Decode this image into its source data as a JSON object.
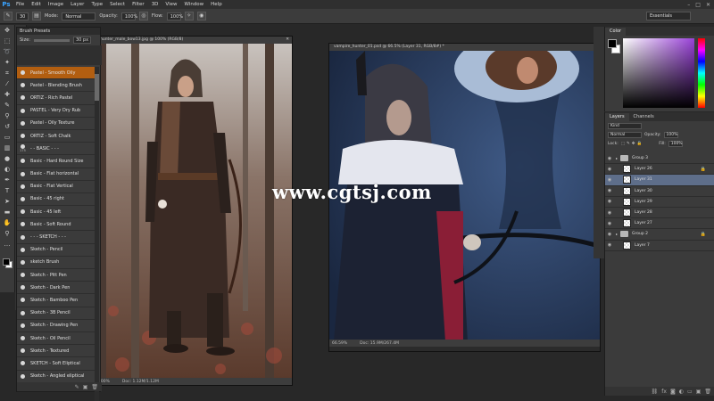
{
  "menu": [
    "File",
    "Edit",
    "Image",
    "Layer",
    "Type",
    "Select",
    "Filter",
    "3D",
    "View",
    "Window",
    "Help"
  ],
  "app_logo": "Ps",
  "options": {
    "mode_label": "Mode:",
    "mode_value": "Normal",
    "opacity_label": "Opacity:",
    "opacity_value": "100%",
    "flow_label": "Flow:",
    "flow_value": "100%",
    "workspace": "Essentials"
  },
  "brush_panel": {
    "title": "Brush Presets",
    "size_label": "Size:",
    "size_value": "30 px",
    "items": [
      {
        "label": "Pastel - Smooth Oily",
        "size": "",
        "selected": true
      },
      {
        "label": "Pastel - Blending Brush",
        "size": ""
      },
      {
        "label": "ORTIZ - Rich Pastel",
        "size": ""
      },
      {
        "label": "PASTEL - Very Dry Rub",
        "size": ""
      },
      {
        "label": "Pastel - Oily Texture",
        "size": ""
      },
      {
        "label": "ORTIZ - Soft Chalk",
        "size": ""
      },
      {
        "label": "- - BASIC - - -",
        "size": "175"
      },
      {
        "label": "Basic - Hard Round Size",
        "size": ""
      },
      {
        "label": "Basic - Flat horizontal",
        "size": ""
      },
      {
        "label": "Basic - Flat Vertical",
        "size": ""
      },
      {
        "label": "Basic - 45 right",
        "size": ""
      },
      {
        "label": "Basic - 45 left",
        "size": ""
      },
      {
        "label": "Basic - Soft Round",
        "size": ""
      },
      {
        "label": "- - - SKETCH - - -",
        "size": ""
      },
      {
        "label": "Sketch - Pencil",
        "size": ""
      },
      {
        "label": "sketch Brush",
        "size": ""
      },
      {
        "label": "Sketch - Pitt Pen",
        "size": ""
      },
      {
        "label": "Sketch - Dark Pen",
        "size": ""
      },
      {
        "label": "Sketch - Bamboo Pen",
        "size": ""
      },
      {
        "label": "Sketch - 3B Pencil",
        "size": ""
      },
      {
        "label": "Sketch - Drawing Pen",
        "size": ""
      },
      {
        "label": "Sketch - Oil Pencil",
        "size": ""
      },
      {
        "label": "Sketch - Textured",
        "size": ""
      },
      {
        "label": "SKETCH - Soft Eliptical",
        "size": ""
      },
      {
        "label": "Sketch - Angled eliptical",
        "size": ""
      }
    ]
  },
  "doc1": {
    "title": "hunter_male_bow13.jpg @ 100% (RGB/8)",
    "zoom": "100%",
    "doc_size": "Doc: 1.12M/1.12M"
  },
  "doc2": {
    "title": "vampire_hunter_01.psd @ 66.5% (Layer 31, RGB/8#) *",
    "zoom": "66.59%",
    "doc_size": "Doc: 15.9M/267.4M"
  },
  "watermark": "www.cgtsj.com",
  "color_panel": {
    "tab1": "Color",
    "tab2": ""
  },
  "layers_panel": {
    "tab1": "Layers",
    "tab2": "Channels",
    "kind": "Kind",
    "blend": "Normal",
    "opacity_label": "Opacity:",
    "opacity_value": "100%",
    "lock_label": "Lock:",
    "fill_label": "Fill:",
    "fill_value": "100%",
    "layers": [
      {
        "name": "Group 3",
        "type": "group",
        "selected": false,
        "locked": false
      },
      {
        "name": "Layer 26",
        "type": "layer",
        "selected": false,
        "locked": true
      },
      {
        "name": "Layer 31",
        "type": "layer",
        "selected": true,
        "locked": false
      },
      {
        "name": "Layer 30",
        "type": "layer",
        "selected": false,
        "locked": false
      },
      {
        "name": "Layer 29",
        "type": "layer",
        "selected": false,
        "locked": false
      },
      {
        "name": "Layer 28",
        "type": "layer",
        "selected": false,
        "locked": false
      },
      {
        "name": "Layer 27",
        "type": "layer",
        "selected": false,
        "locked": false
      },
      {
        "name": "Group 2",
        "type": "group",
        "selected": false,
        "locked": true
      },
      {
        "name": "Layer 7",
        "type": "layer",
        "selected": false,
        "locked": false
      }
    ]
  },
  "colors": {
    "selected_brush": "#b25e10",
    "selected_layer": "#5e6e8a",
    "ps_blue": "#3aa3ff"
  }
}
